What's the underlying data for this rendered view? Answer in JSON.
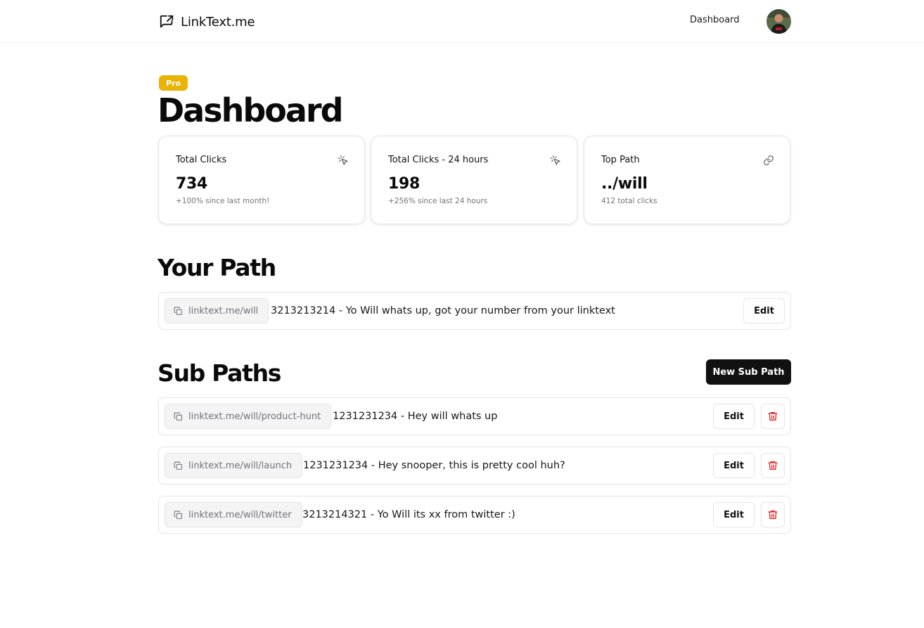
{
  "header": {
    "brand": "LinkText.me",
    "nav_dashboard": "Dashboard",
    "brand_icon": "message-share-icon"
  },
  "page": {
    "badge": "Pro",
    "title": "Dashboard"
  },
  "stats": [
    {
      "label": "Total Clicks",
      "value": "734",
      "sub": "+100% since last month!",
      "icon": "pointer-click-icon"
    },
    {
      "label": "Total Clicks - 24 hours",
      "value": "198",
      "sub": "+256% since last 24 hours",
      "icon": "pointer-click-icon"
    },
    {
      "label": "Top Path",
      "value": "../will",
      "sub": "412 total clicks",
      "icon": "link-icon"
    }
  ],
  "your_path": {
    "title": "Your Path",
    "path": "linktext.me/will",
    "text": "3213213214 - Yo Will whats up, got your number from your linktext",
    "edit_label": "Edit"
  },
  "sub_paths": {
    "title": "Sub Paths",
    "new_label": "New Sub Path",
    "items": [
      {
        "path": "linktext.me/will/product-hunt",
        "text": "1231231234 - Hey will whats up",
        "edit_label": "Edit"
      },
      {
        "path": "linktext.me/will/launch",
        "text": "1231231234 - Hey snooper, this is pretty cool huh?",
        "edit_label": "Edit"
      },
      {
        "path": "linktext.me/will/twitter",
        "text": "3213214321 - Yo Will its xx from twitter :)",
        "edit_label": "Edit"
      }
    ]
  },
  "colors": {
    "badge": "#eab308",
    "primary_button": "#111111",
    "delete": "#dc2626",
    "muted_text": "#737373"
  }
}
